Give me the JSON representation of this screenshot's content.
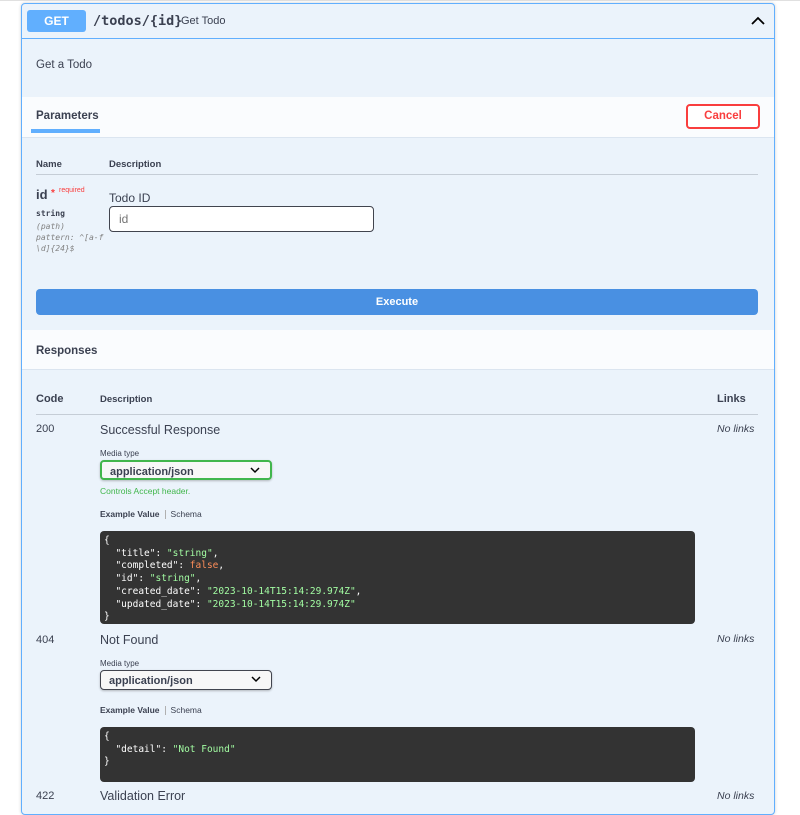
{
  "operation": {
    "method": "GET",
    "path": "/todos/{id}",
    "summary": "Get Todo",
    "description": "Get a Todo",
    "accent_color": "#61affe"
  },
  "parameters": {
    "tab_label": "Parameters",
    "cancel_label": "Cancel",
    "col_name": "Name",
    "col_description": "Description",
    "items": [
      {
        "name": "id",
        "required_star": "*",
        "required_label": "required",
        "type": "string",
        "in": "(path)",
        "pattern": "pattern: ^[a-f\\d]{24}$",
        "description": "Todo ID",
        "input_placeholder": "id",
        "input_value": ""
      }
    ]
  },
  "execute_label": "Execute",
  "responses": {
    "title": "Responses",
    "col_code": "Code",
    "col_description": "Description",
    "col_links": "Links",
    "items": [
      {
        "code": "200",
        "description": "Successful Response",
        "links": "No links",
        "media_type_label": "Media type",
        "media_type": "application/json",
        "controls_note": "Controls Accept header.",
        "example_tab": "Example Value",
        "schema_tab": "Schema",
        "example": [
          {
            "key": "title",
            "value": "\"string\"",
            "kind": "string"
          },
          {
            "key": "completed",
            "value": "false",
            "kind": "bool"
          },
          {
            "key": "id",
            "value": "\"string\"",
            "kind": "string"
          },
          {
            "key": "created_date",
            "value": "\"2023-10-14T15:14:29.974Z\"",
            "kind": "string"
          },
          {
            "key": "updated_date",
            "value": "\"2023-10-14T15:14:29.974Z\"",
            "kind": "string"
          }
        ]
      },
      {
        "code": "404",
        "description": "Not Found",
        "links": "No links",
        "media_type_label": "Media type",
        "media_type": "application/json",
        "example_tab": "Example Value",
        "schema_tab": "Schema",
        "example": [
          {
            "key": "detail",
            "value": "\"Not Found\"",
            "kind": "string"
          }
        ]
      },
      {
        "code": "422",
        "description": "Validation Error",
        "links": "No links"
      }
    ]
  }
}
